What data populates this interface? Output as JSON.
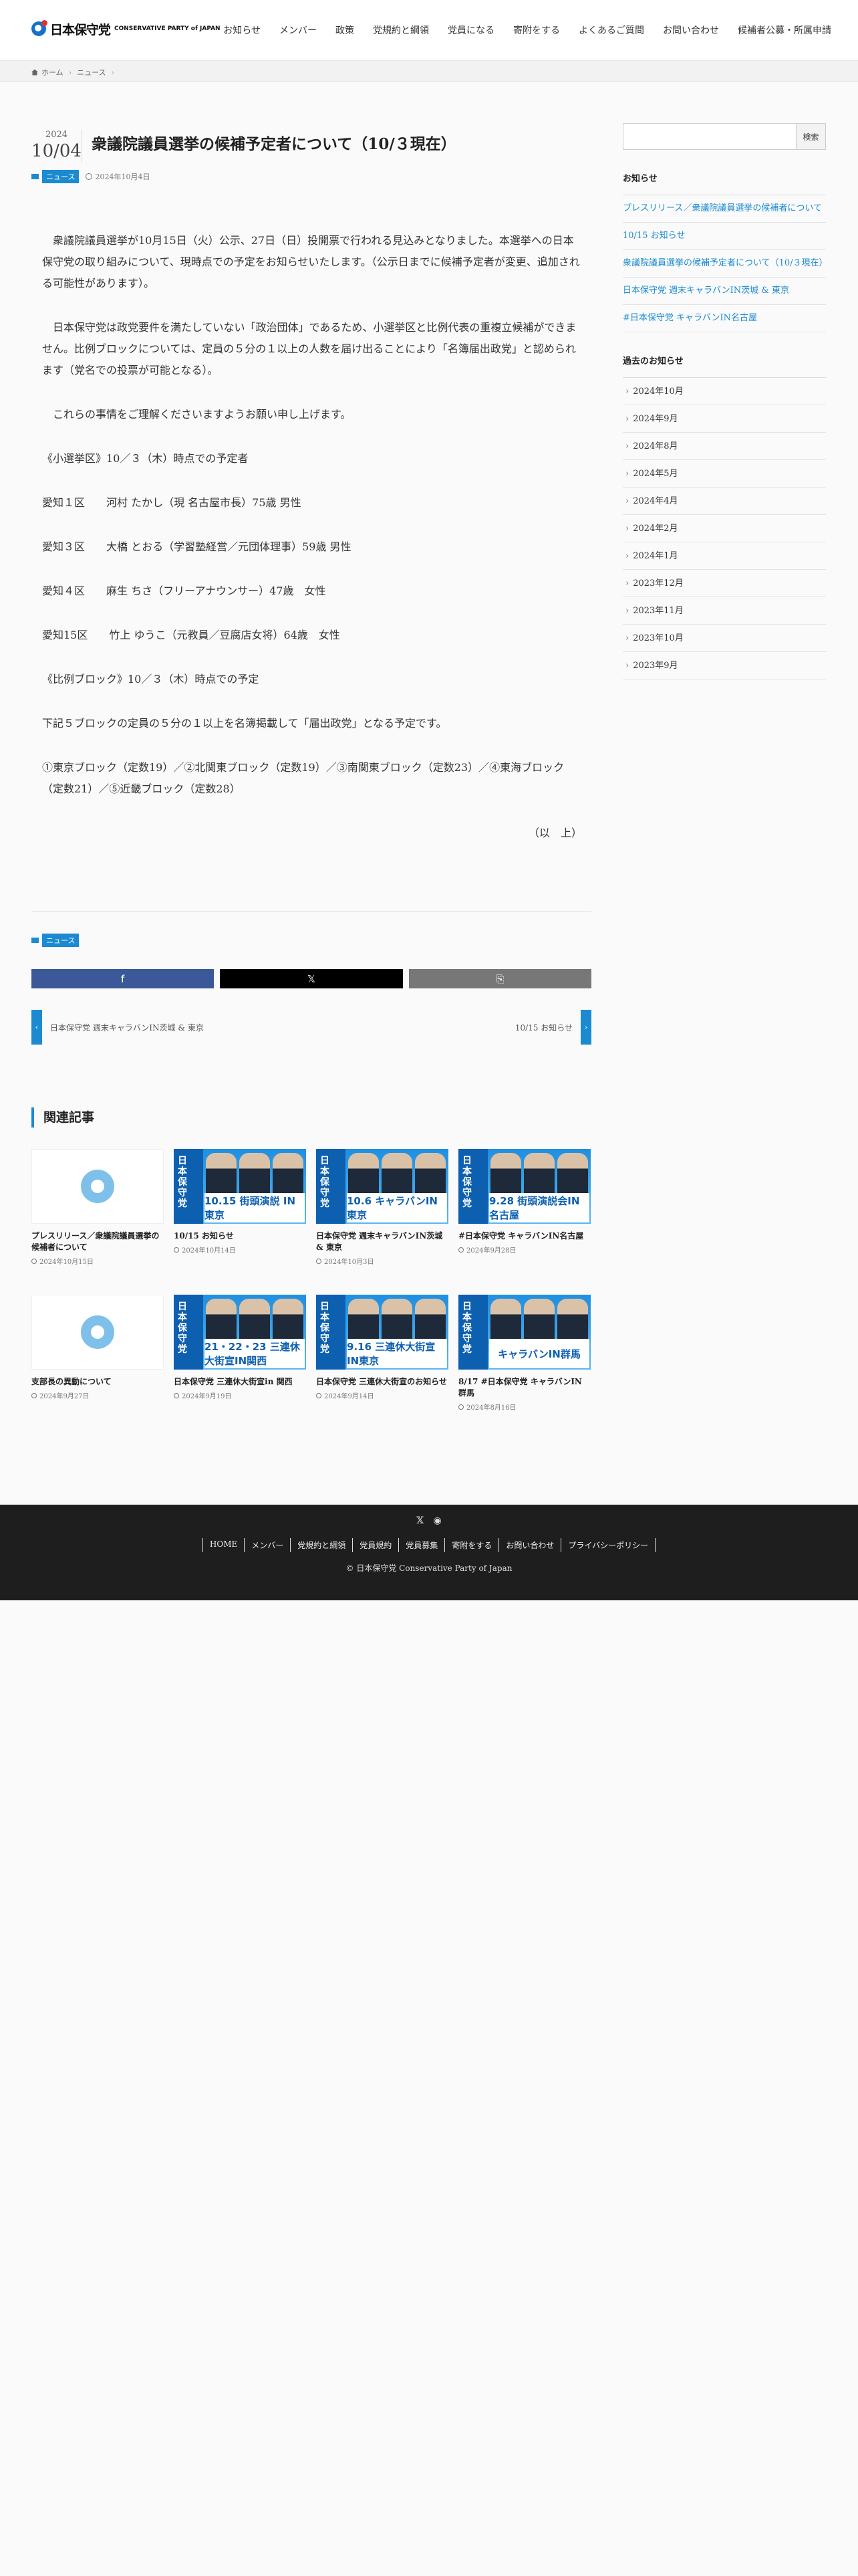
{
  "header": {
    "logo_jp": "日本保守党",
    "logo_en": "CONSERVATIVE PARTY of JAPAN",
    "nav": [
      "お知らせ",
      "メンバー",
      "政策",
      "党規約と綱領",
      "党員になる",
      "寄附をする",
      "よくあるご質問",
      "お問い合わせ",
      "候補者公募・所属申請"
    ]
  },
  "breadcrumb": {
    "home": "ホーム",
    "category": "ニュース"
  },
  "article": {
    "year": "2024",
    "month_day": "10/04",
    "title": "衆議院議員選挙の候補予定者について（10/３現在）",
    "category": "ニュース",
    "date": "2024年10月4日",
    "paragraphs": [
      "　衆議院議員選挙が10月15日（火）公示、27日（日）投開票で行われる見込みとなりました。本選挙への日本保守党の取り組みについて、現時点での予定をお知らせいたします。（公示日までに候補予定者が変更、追加される可能性があります）。",
      "　日本保守党は政党要件を満たしていない「政治団体」であるため、小選挙区と比例代表の重複立候補ができません。比例ブロックについては、定員の５分の１以上の人数を届け出ることにより「名簿届出政党」と認められます（党名での投票が可能となる）。",
      "　これらの事情をご理解くださいますようお願い申し上げます。",
      "《小選挙区》10／３（木）時点での予定者",
      "愛知１区　　河村 たかし（現 名古屋市長）75歳 男性",
      "愛知３区　　大橋 とおる（学習塾経営／元団体理事）59歳 男性",
      "愛知４区　　麻生 ちさ（フリーアナウンサー）47歳　女性",
      "愛知15区　　竹上 ゆうこ（元教員／豆腐店女将）64歳　女性",
      "《比例ブロック》10／３（木）時点での予定",
      "下記５ブロックの定員の５分の１以上を名簿掲載して「届出政党」となる予定です。",
      "①東京ブロック（定数19）／②北関東ブロック（定数19）／③南関東ブロック（定数23）／④東海ブロック（定数21）／⑤近畿ブロック（定数28）"
    ],
    "closing": "（以　上）"
  },
  "prev_post": "日本保守党 週末キャラバンIN茨城 & 東京",
  "next_post": "10/15 お知らせ",
  "related": {
    "heading": "関連記事",
    "items": [
      {
        "title": "プレスリリース／衆議院議員選挙の候補者について",
        "date": "2024年10月15日",
        "thumb": "placeholder",
        "banner": ""
      },
      {
        "title": "10/15 お知らせ",
        "date": "2024年10月14日",
        "thumb": "poster",
        "banner": "10.15 街頭演説 IN東京"
      },
      {
        "title": "日本保守党 週末キャラバンIN茨城 & 東京",
        "date": "2024年10月3日",
        "thumb": "poster",
        "banner": "10.6 キャラバンIN東京"
      },
      {
        "title": "#日本保守党 キャラバンIN名古屋",
        "date": "2024年9月28日",
        "thumb": "poster",
        "banner": "9.28 街頭演説会IN名古屋"
      },
      {
        "title": "支部長の異動について",
        "date": "2024年9月27日",
        "thumb": "placeholder",
        "banner": ""
      },
      {
        "title": "日本保守党 三連休大街宣in 関西",
        "date": "2024年9月19日",
        "thumb": "poster",
        "banner": "21・22・23 三連休大街宣IN関西"
      },
      {
        "title": "日本保守党 三連休大街宣のお知らせ",
        "date": "2024年9月14日",
        "thumb": "poster",
        "banner": "9.16 三連休大街宣IN東京"
      },
      {
        "title": "8/17 #日本保守党 キャラバンIN 群馬",
        "date": "2024年8月16日",
        "thumb": "poster",
        "banner": "キャラバンIN群馬"
      }
    ]
  },
  "sidebar": {
    "search_button": "検索",
    "news_heading": "お知らせ",
    "news": [
      "プレスリリース／衆議院議員選挙の候補者について",
      "10/15 お知らせ",
      "衆議院議員選挙の候補予定者について（10/３現在）",
      "日本保守党 週末キャラバンIN茨城 & 東京",
      "#日本保守党 キャラバンIN名古屋"
    ],
    "archive_heading": "過去のお知らせ",
    "archives": [
      "2024年10月",
      "2024年9月",
      "2024年8月",
      "2024年5月",
      "2024年4月",
      "2024年2月",
      "2024年1月",
      "2023年12月",
      "2023年11月",
      "2023年10月",
      "2023年9月"
    ]
  },
  "footer": {
    "social": [
      "X",
      "RSS"
    ],
    "nav": [
      "HOME",
      "メンバー",
      "党規約と綱領",
      "党員規約",
      "党員募集",
      "寄附をする",
      "お問い合わせ",
      "プライバシーポリシー"
    ],
    "copyright": "© 日本保守党 Conservative Party of Japan"
  },
  "colors": {
    "accent": "#1b8ad1",
    "facebook": "#3b5998",
    "x": "#000000",
    "copy": "#777777",
    "footer": "#1e1e1e"
  }
}
